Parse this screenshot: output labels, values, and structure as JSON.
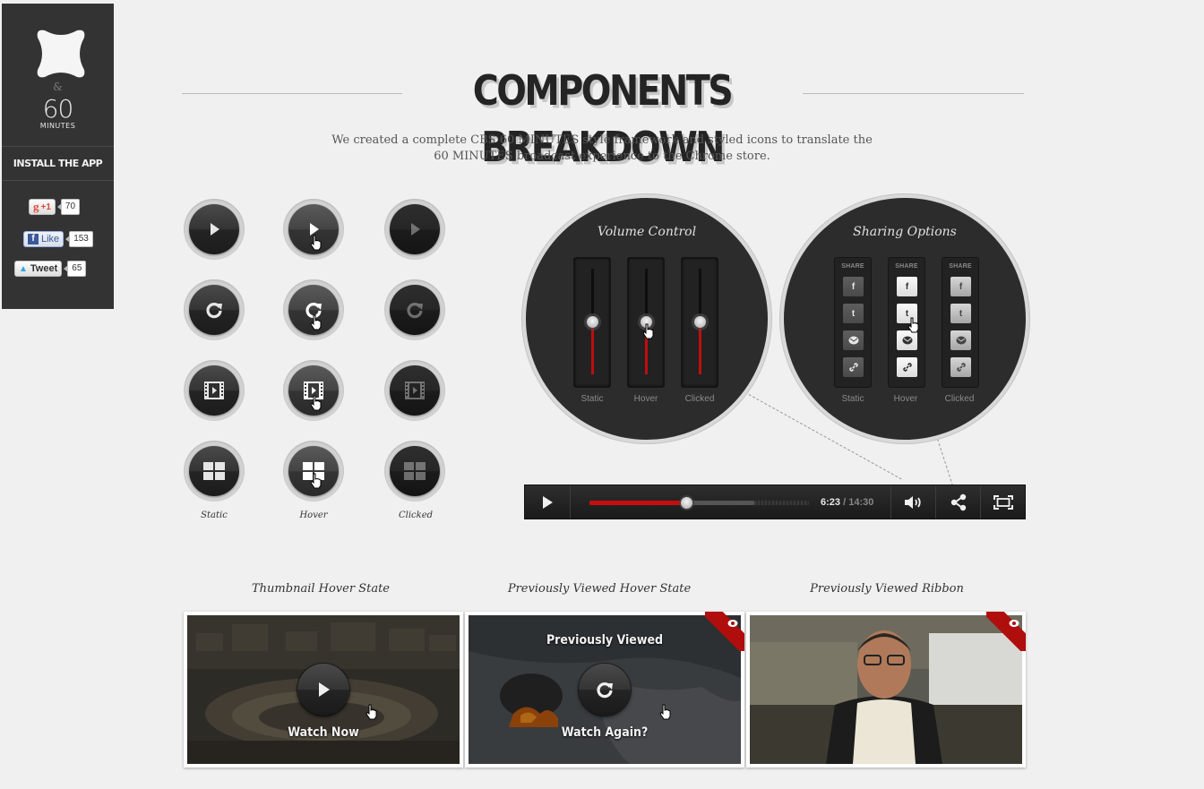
{
  "sidebar": {
    "brand_amp": "&",
    "brand_number": "60",
    "brand_word": "MINUTES",
    "install_label": "INSTALL THE APP",
    "gplus": {
      "label": "+1",
      "count": "70"
    },
    "facebook": {
      "label": "Like",
      "count": "153"
    },
    "twitter": {
      "label": "Tweet",
      "count": "65"
    }
  },
  "header": {
    "title": "COMPONENTS BREAKDOWN",
    "intro_line1": "We created a complete CBS 60 MINUTES style framework and styled icons to translate the",
    "intro_line2": "60 MINUTES broadcast experience to the Chrome store."
  },
  "button_grid": {
    "rows": [
      "play-icon",
      "replay-icon",
      "film-icon",
      "grid-icon"
    ],
    "states": [
      "Static",
      "Hover",
      "Clicked"
    ]
  },
  "volume_panel": {
    "title": "Volume Control",
    "levels": [
      0.5,
      0.5,
      0.5
    ],
    "labels": [
      "Static",
      "Hover",
      "Clicked"
    ]
  },
  "sharing_panel": {
    "title": "Sharing Options",
    "header": "SHARE",
    "buttons": [
      "f",
      "t",
      "email-icon",
      "link-icon"
    ],
    "labels": [
      "Static",
      "Hover",
      "Clicked"
    ]
  },
  "player": {
    "current_time": "6:23",
    "separator": " / ",
    "duration": "14:30",
    "progress": 0.44,
    "buffered": 0.75
  },
  "thumbnails": [
    {
      "caption": "Thumbnail Hover State",
      "overlay_label": "Watch Now"
    },
    {
      "caption": "Previously Viewed Hover State",
      "overlay_heading": "Previously Viewed",
      "overlay_label": "Watch Again?"
    },
    {
      "caption": "Previously Viewed Ribbon"
    }
  ],
  "colors": {
    "accent_red": "#c80d0d",
    "dark_panel": "#2c2c2c",
    "sidebar_bg": "#333333",
    "page_bg": "#f0f0f0"
  }
}
